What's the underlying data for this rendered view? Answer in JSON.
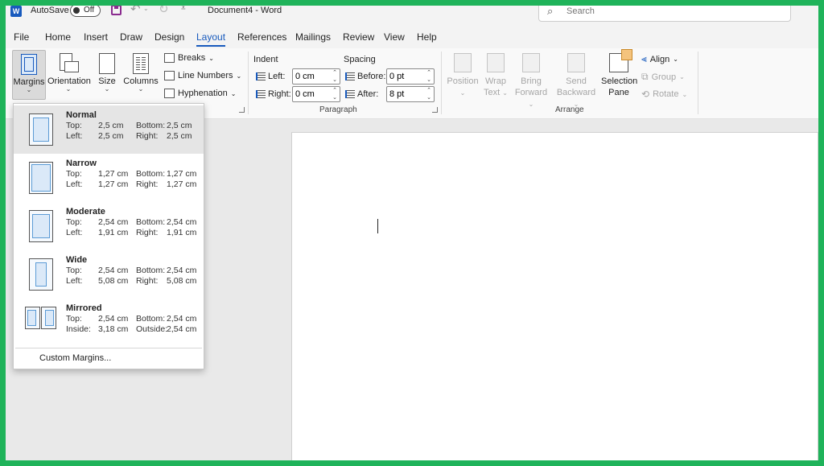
{
  "titlebar": {
    "app_letter": "W",
    "autosave_label": "AutoSave",
    "autosave_state": "Off",
    "document_title": "Document4  -  Word",
    "search_placeholder": "Search"
  },
  "menu": {
    "tabs": [
      "File",
      "Home",
      "Insert",
      "Draw",
      "Design",
      "Layout",
      "References",
      "Mailings",
      "Review",
      "View",
      "Help"
    ],
    "active": "Layout"
  },
  "ribbon": {
    "page_setup": {
      "margins": "Margins",
      "orientation": "Orientation",
      "size": "Size",
      "columns": "Columns",
      "breaks": "Breaks",
      "line_numbers": "Line Numbers",
      "hyphenation": "Hyphenation"
    },
    "paragraph": {
      "indent_header": "Indent",
      "spacing_header": "Spacing",
      "left_label": "Left:",
      "left_value": "0 cm",
      "right_label": "Right:",
      "right_value": "0 cm",
      "before_label": "Before:",
      "before_value": "0 pt",
      "after_label": "After:",
      "after_value": "8 pt",
      "group_label": "Paragraph"
    },
    "arrange": {
      "position": "Position",
      "wrap_1": "Wrap",
      "wrap_2": "Text",
      "bring_1": "Bring",
      "bring_2": "Forward",
      "send_1": "Send",
      "send_2": "Backward",
      "selection_1": "Selection",
      "selection_2": "Pane",
      "align": "Align",
      "group": "Group",
      "rotate": "Rotate",
      "group_label": "Arrange"
    }
  },
  "margins_menu": {
    "options": [
      {
        "name": "Normal",
        "k1": "Top:",
        "v1": "2,5 cm",
        "k2": "Bottom:",
        "v2": "2,5 cm",
        "k3": "Left:",
        "v3": "2,5 cm",
        "k4": "Right:",
        "v4": "2,5 cm"
      },
      {
        "name": "Narrow",
        "k1": "Top:",
        "v1": "1,27 cm",
        "k2": "Bottom:",
        "v2": "1,27 cm",
        "k3": "Left:",
        "v3": "1,27 cm",
        "k4": "Right:",
        "v4": "1,27 cm"
      },
      {
        "name": "Moderate",
        "k1": "Top:",
        "v1": "2,54 cm",
        "k2": "Bottom:",
        "v2": "2,54 cm",
        "k3": "Left:",
        "v3": "1,91 cm",
        "k4": "Right:",
        "v4": "1,91 cm"
      },
      {
        "name": "Wide",
        "k1": "Top:",
        "v1": "2,54 cm",
        "k2": "Bottom:",
        "v2": "2,54 cm",
        "k3": "Left:",
        "v3": "5,08 cm",
        "k4": "Right:",
        "v4": "5,08 cm"
      },
      {
        "name": "Mirrored",
        "k1": "Top:",
        "v1": "2,54 cm",
        "k2": "Bottom:",
        "v2": "2,54 cm",
        "k3": "Inside:",
        "v3": "3,18 cm",
        "k4": "Outside:",
        "v4": "2,54 cm"
      }
    ],
    "custom": "Custom Margins..."
  },
  "colors": {
    "accent": "#185abd",
    "frame": "#1fb35a"
  }
}
